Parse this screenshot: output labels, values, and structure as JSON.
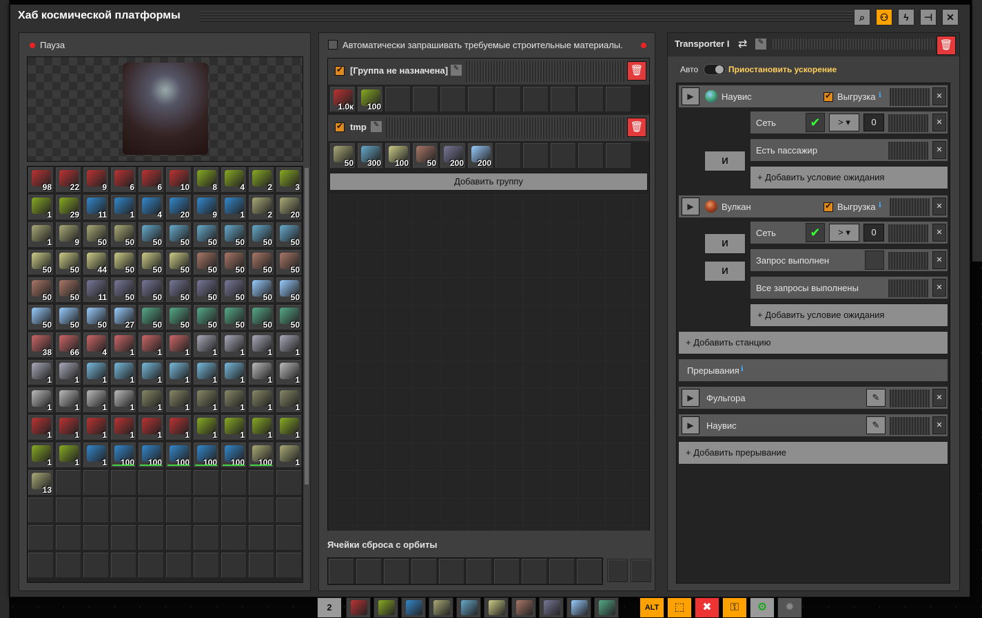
{
  "window": {
    "title": "Хаб космической платформы",
    "toolbar": [
      "search-icon",
      "network-icon",
      "power-icon",
      "pin-icon",
      "close-icon"
    ]
  },
  "left": {
    "status": "Пауза",
    "inventory": [
      "98",
      "22",
      "9",
      "6",
      "6",
      "10",
      "8",
      "4",
      "2",
      "3",
      "1",
      "29",
      "11",
      "1",
      "4",
      "20",
      "9",
      "1",
      "2",
      "20",
      "1",
      "9",
      "50",
      "50",
      "50",
      "50",
      "50",
      "50",
      "50",
      "50",
      "50",
      "50",
      "44",
      "50",
      "50",
      "50",
      "50",
      "50",
      "50",
      "50",
      "50",
      "50",
      "11",
      "50",
      "50",
      "50",
      "50",
      "50",
      "50",
      "50",
      "50",
      "50",
      "50",
      "27",
      "50",
      "50",
      "50",
      "50",
      "50",
      "50",
      "38",
      "66",
      "4",
      "1",
      "1",
      "1",
      "1",
      "1",
      "1",
      "1",
      "1",
      "1",
      "1",
      "1",
      "1",
      "1",
      "1",
      "1",
      "1",
      "1",
      "1",
      "1",
      "1",
      "1",
      "1",
      "1",
      "1",
      "1",
      "1",
      "1",
      "1",
      "1",
      "1",
      "1",
      "1",
      "1",
      "1",
      "1",
      "1",
      "1",
      "1",
      "1",
      "1",
      "100",
      "100",
      "100",
      "100",
      "100",
      "100",
      "1",
      "13"
    ]
  },
  "middle": {
    "auto_request": "Автоматически запрашивать требуемые строительные материалы.",
    "groups": [
      {
        "name": "[Группа не назначена]",
        "items": [
          "1.0к",
          "100"
        ]
      },
      {
        "name": "tmp",
        "items": [
          "50",
          "300",
          "100",
          "50",
          "200",
          "200"
        ]
      }
    ],
    "add_group": "Добавить группу",
    "drop_slots": "Ячейки сброса с орбиты"
  },
  "right": {
    "name": "Transporter I",
    "auto": "Авто",
    "pause_accel": "Приостановить ускорение",
    "stations": [
      {
        "name": "Наувис",
        "unload": "Выгрузка",
        "conditions": [
          {
            "text": "Сеть",
            "op": ">",
            "val": "0"
          },
          {
            "text": "Есть пассажир"
          }
        ],
        "joins": [
          "И"
        ]
      },
      {
        "name": "Вулкан",
        "unload": "Выгрузка",
        "conditions": [
          {
            "text": "Сеть",
            "op": ">",
            "val": "0"
          },
          {
            "text": "Запрос выполнен"
          },
          {
            "text": "Все запросы выполнены"
          }
        ],
        "joins": [
          "И",
          "И"
        ]
      }
    ],
    "add_wait": "+ Добавить условие ожидания",
    "add_station": "+ Добавить станцию",
    "interrupts_label": "Прерывания",
    "interrupts": [
      "Фульгора",
      "Наувис"
    ],
    "add_interrupt": "+ Добавить прерывание"
  },
  "hotbar": {
    "page": "2",
    "alt_label": "ALT"
  }
}
